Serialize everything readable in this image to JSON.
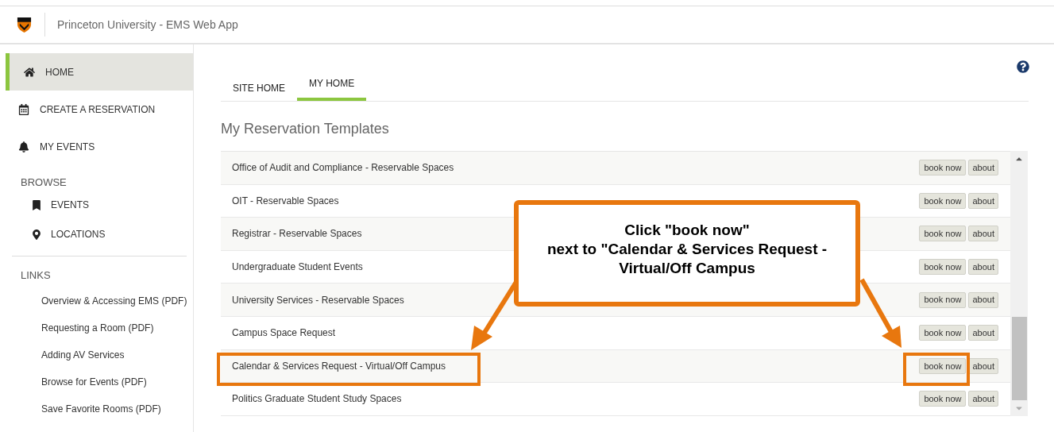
{
  "header": {
    "title": "Princeton University - EMS Web App"
  },
  "nav": [
    {
      "label": "HOME",
      "kind": "home",
      "selected": true
    },
    {
      "label": "CREATE A RESERVATION",
      "kind": "calendar",
      "selected": false
    },
    {
      "label": "MY EVENTS",
      "kind": "bell",
      "selected": false
    }
  ],
  "browse": {
    "heading": "BROWSE",
    "items": [
      {
        "label": "EVENTS",
        "kind": "bookmark"
      },
      {
        "label": "LOCATIONS",
        "kind": "pin"
      }
    ]
  },
  "links": {
    "heading": "LINKS",
    "items": [
      "Overview & Accessing EMS (PDF)",
      "Requesting a Room (PDF)",
      "Adding AV Services",
      "Browse for Events (PDF)",
      "Save Favorite Rooms (PDF)"
    ]
  },
  "tabs": [
    {
      "label": "SITE HOME",
      "selected": false
    },
    {
      "label": "MY HOME",
      "selected": true
    }
  ],
  "section_title": "My Reservation Templates",
  "templates": [
    {
      "name": "Office of Audit and Compliance - Reservable Spaces",
      "book": "book now",
      "about": "about",
      "name_highlighted": false,
      "book_highlighted": false
    },
    {
      "name": "OIT - Reservable Spaces",
      "book": "book now",
      "about": "about",
      "name_highlighted": false,
      "book_highlighted": false
    },
    {
      "name": "Registrar - Reservable Spaces",
      "book": "book now",
      "about": "about",
      "name_highlighted": false,
      "book_highlighted": false
    },
    {
      "name": "Undergraduate Student Events",
      "book": "book now",
      "about": "about",
      "name_highlighted": false,
      "book_highlighted": false
    },
    {
      "name": "University Services - Reservable Spaces",
      "book": "book now",
      "about": "about",
      "name_highlighted": false,
      "book_highlighted": false
    },
    {
      "name": "Campus Space Request",
      "book": "book now",
      "about": "about",
      "name_highlighted": false,
      "book_highlighted": false
    },
    {
      "name": "Calendar & Services Request - Virtual/Off Campus",
      "book": "book now",
      "about": "about",
      "name_highlighted": true,
      "book_highlighted": true
    },
    {
      "name": "Politics Graduate Student Study Spaces",
      "book": "book now",
      "about": "about",
      "name_highlighted": false,
      "book_highlighted": false
    }
  ],
  "callout": {
    "lines": [
      "Click \"book now\"",
      "next to \"Calendar & Services Request - Virtual/Off Campus"
    ]
  }
}
